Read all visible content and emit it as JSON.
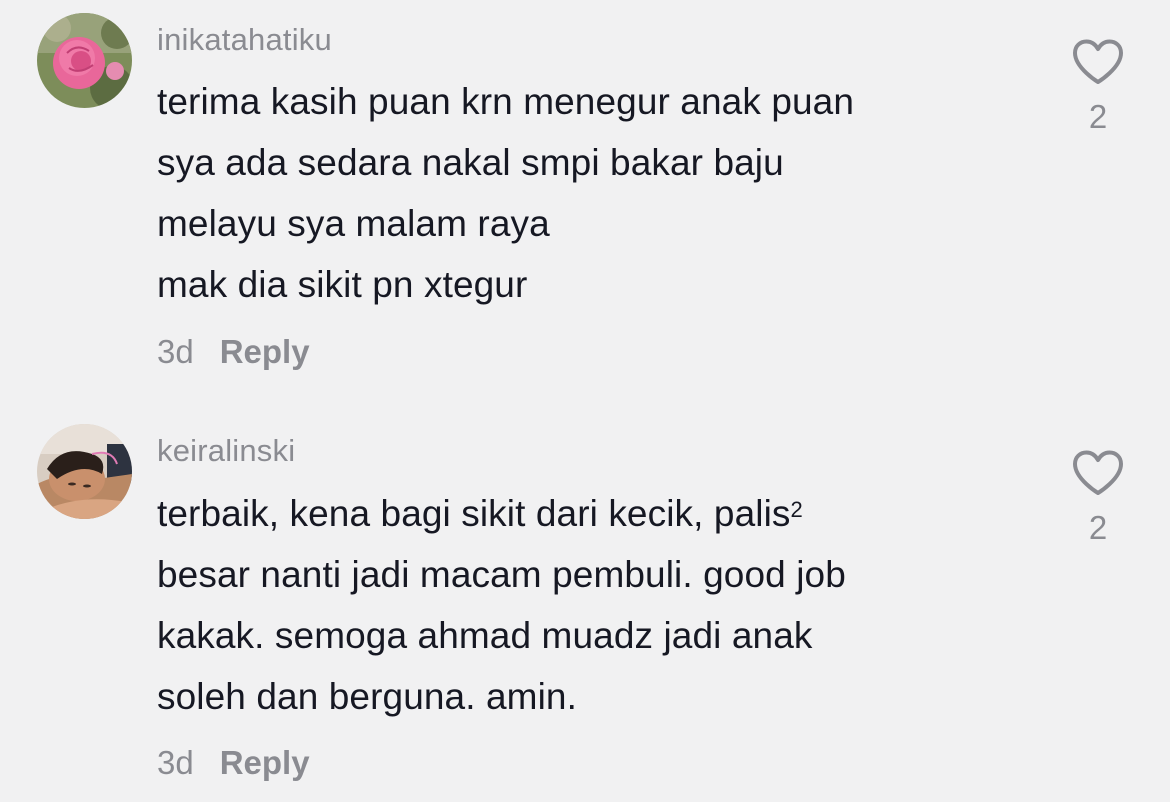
{
  "comments": [
    {
      "username": "inikatahatiku",
      "lines": [
        "terima kasih puan krn menegur anak puan",
        "sya ada sedara nakal smpi bakar baju",
        "melayu sya malam raya",
        "mak dia sikit pn xtegur"
      ],
      "time": "3d",
      "reply_label": "Reply",
      "like_count": "2",
      "avatar_icon": "rose-photo-avatar",
      "avatar_colors": {
        "bg": "#6b7f4e",
        "flower": "#e9679a"
      }
    },
    {
      "username": "keiralinski",
      "lines": [
        "terbaik, kena bagi sikit dari kecik, palis",
        "besar nanti jadi macam pembuli. good job",
        "kakak. semoga ahmad muadz jadi anak",
        "soleh dan berguna. amin."
      ],
      "line1_suffix": "2",
      "time": "3d",
      "reply_label": "Reply",
      "like_count": "2",
      "avatar_icon": "person-photo-avatar",
      "avatar_colors": {
        "bg": "#cfc3b8",
        "skin": "#c9906c"
      }
    }
  ],
  "icons": {
    "like": "heart-outline-icon"
  },
  "colors": {
    "background": "#f1f1f2",
    "text": "#161823",
    "muted": "#8a8b91"
  }
}
